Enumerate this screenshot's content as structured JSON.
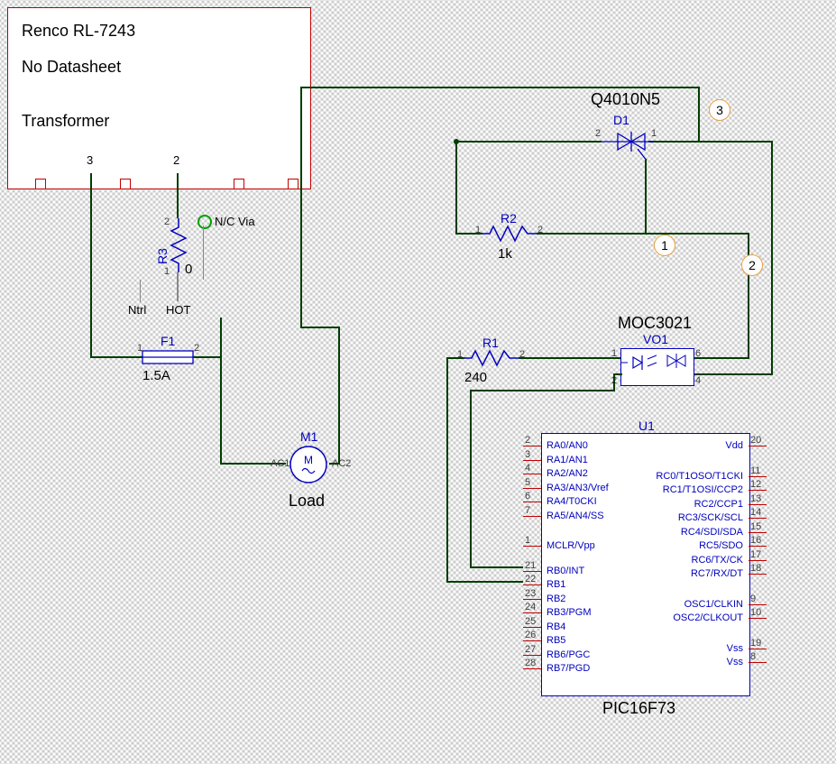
{
  "transformer": {
    "line1": "Renco RL-7243",
    "line2": "No Datasheet",
    "line3": "Transformer",
    "pin3": "3",
    "pin2": "2"
  },
  "r3": {
    "ref": "R3",
    "val": "0"
  },
  "r2": {
    "ref": "R2",
    "val": "1k"
  },
  "r1": {
    "ref": "R1",
    "val": "240"
  },
  "fuse": {
    "ref": "F1",
    "val": "1.5A"
  },
  "motor": {
    "ref": "M1",
    "label": "Load",
    "ac1": "AC1",
    "ac2": "AC2"
  },
  "triac": {
    "part": "Q4010N5",
    "ref": "D1"
  },
  "opto": {
    "part": "MOC3021",
    "ref": "VO1"
  },
  "via": {
    "label": "N/C Via"
  },
  "power": {
    "ntrl": "Ntrl",
    "hot": "HOT"
  },
  "chip": {
    "ref": "U1",
    "part": "PIC16F73",
    "left": [
      {
        "n": "2",
        "l": "RA0/AN0"
      },
      {
        "n": "3",
        "l": "RA1/AN1"
      },
      {
        "n": "4",
        "l": "RA2/AN2"
      },
      {
        "n": "5",
        "l": "RA3/AN3/Vref"
      },
      {
        "n": "6",
        "l": "RA4/T0CKI"
      },
      {
        "n": "7",
        "l": "RA5/AN4/SS"
      },
      {
        "n": "1",
        "l": "MCLR/Vpp"
      },
      {
        "n": "21",
        "l": "RB0/INT"
      },
      {
        "n": "22",
        "l": "RB1"
      },
      {
        "n": "23",
        "l": "RB2"
      },
      {
        "n": "24",
        "l": "RB3/PGM"
      },
      {
        "n": "25",
        "l": "RB4"
      },
      {
        "n": "26",
        "l": "RB5"
      },
      {
        "n": "27",
        "l": "RB6/PGC"
      },
      {
        "n": "28",
        "l": "RB7/PGD"
      }
    ],
    "right": [
      {
        "n": "20",
        "l": "Vdd"
      },
      {
        "n": "11",
        "l": "RC0/T1OSO/T1CKI"
      },
      {
        "n": "12",
        "l": "RC1/T1OSI/CCP2"
      },
      {
        "n": "13",
        "l": "RC2/CCP1"
      },
      {
        "n": "14",
        "l": "RC3/SCK/SCL"
      },
      {
        "n": "15",
        "l": "RC4/SDI/SDA"
      },
      {
        "n": "16",
        "l": "RC5/SDO"
      },
      {
        "n": "17",
        "l": "RC6/TX/CK"
      },
      {
        "n": "18",
        "l": "RC7/RX/DT"
      },
      {
        "n": "9",
        "l": "OSC1/CLKIN"
      },
      {
        "n": "10",
        "l": "OSC2/CLKOUT"
      },
      {
        "n": "19",
        "l": "Vss"
      },
      {
        "n": "8",
        "l": "Vss"
      }
    ]
  },
  "nodes": {
    "n1": "1",
    "n2": "2",
    "n3": "3"
  },
  "pins": {
    "p1": "1",
    "p2": "2",
    "p4": "4",
    "p6": "6"
  }
}
